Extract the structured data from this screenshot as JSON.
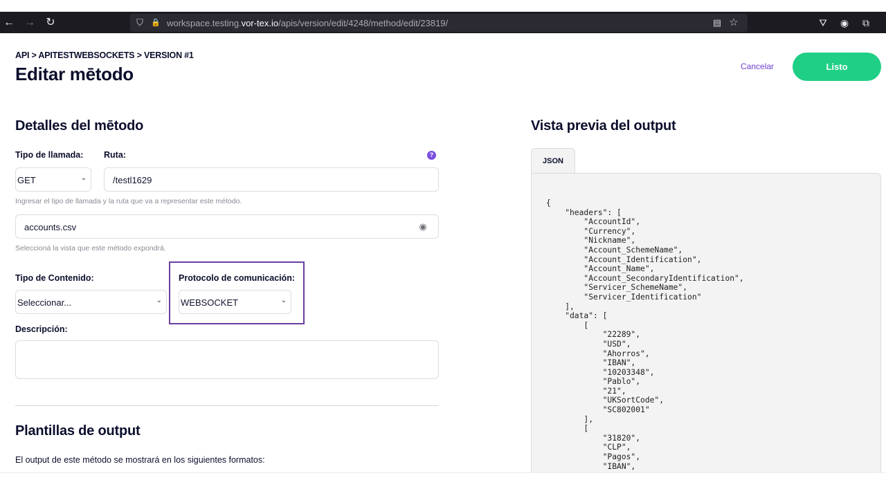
{
  "browser": {
    "url_prefix": "workspace.testing.",
    "url_domain": "vor-tex.io",
    "url_path": "/apis/version/edit/4248/method/edit/23819/",
    "icons": {
      "back": "←",
      "forward": "→",
      "reload": "↻",
      "shield": "⛉",
      "lock": "🔒",
      "reader": "▤",
      "star": "☆",
      "pocket": "⛛",
      "account": "◉",
      "extensions": "⧉"
    }
  },
  "header": {
    "breadcrumb": "API > APITESTWEBSOCKETS > VERSION #1",
    "title": "Editar mētodo",
    "cancel_label": "Cancelar",
    "done_label": "Listo"
  },
  "details": {
    "section_title": "Detalles del mētodo",
    "call_type_label": "Tipo de llamada:",
    "call_type_value": "GET",
    "route_label": "Ruta:",
    "route_value": "/testl1629",
    "route_help": "Ingresar el tipo de llamada y la ruta que va a representar este método.",
    "view_value": "accounts.csv",
    "view_help": "Seleccioná la vista que este método expondrá.",
    "content_type_label": "Tipo de Contenido:",
    "content_type_value": "Seleccionar...",
    "protocol_label": "Protocolo de comunicación:",
    "protocol_value": "WEBSOCKET",
    "description_label": "Descripción:",
    "help_icon": "?",
    "eye_icon": "◉",
    "chevron": "⌄"
  },
  "templates": {
    "section_title": "Plantillas de output",
    "body": "El output de este método se mostrará en los siguientes formatos:"
  },
  "preview": {
    "section_title": "Vista previa del output",
    "tab_label": "JSON",
    "json_text": "{\n    \"headers\": [\n        \"AccountId\",\n        \"Currency\",\n        \"Nickname\",\n        \"Account_SchemeName\",\n        \"Account_Identification\",\n        \"Account_Name\",\n        \"Account_SecondaryIdentification\",\n        \"Servicer_SchemeName\",\n        \"Servicer_Identification\"\n    ],\n    \"data\": [\n        [\n            \"22289\",\n            \"USD\",\n            \"Ahorros\",\n            \"IBAN\",\n            \"10203348\",\n            \"Pablo\",\n            \"21\",\n            \"UKSortCode\",\n            \"SC802001\"\n        ],\n        [\n            \"31820\",\n            \"CLP\",\n            \"Pagos\",\n            \"IBAN\","
  }
}
